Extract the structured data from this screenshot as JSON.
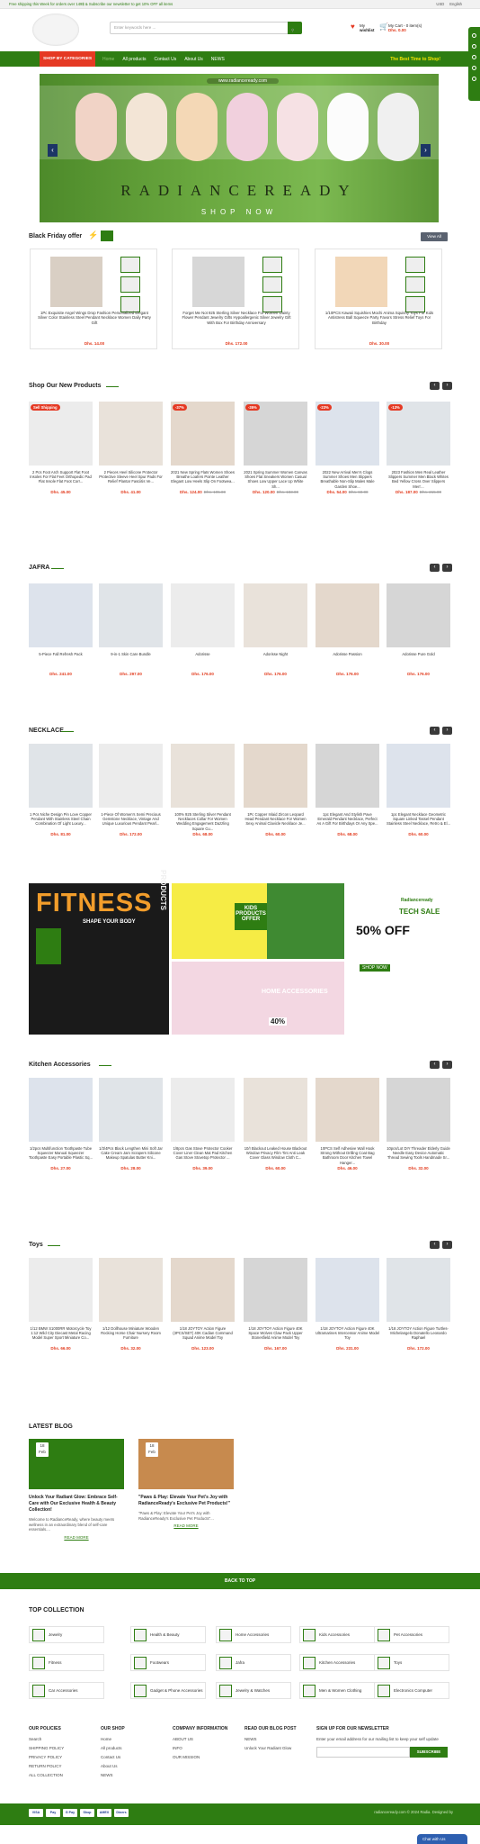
{
  "topbar": {
    "promo": "Free shipping this Week for orders over 149$ & Subscribe our newsletter to get 10% OFF all items",
    "currency": "USD",
    "language": "English"
  },
  "header": {
    "search_placeholder": "Enter keywords here ...",
    "wishlist_line1": "My",
    "wishlist_line2": "wishlist",
    "cart_line1": "My Cart - 0 item(s)",
    "cart_price": "Dhs. 0.00"
  },
  "nav": {
    "categories": "SHOP BY CATEGORIES",
    "links": [
      "Home",
      "All products",
      "Contact Us",
      "About Us",
      "NEWS"
    ],
    "best_time": "The Best Time to Shop!"
  },
  "hero": {
    "url": "www.radianceready.com",
    "brand": "RADIANCEREADY",
    "cta": "SHOP NOW"
  },
  "black_friday": {
    "title": "Black Friday offer",
    "view_all": "View All",
    "cards": [
      {
        "name": "1Pc Exquisite Angel Wings Drop Fashion Personalized Elegant Silver Color Stainless Steel Pendant Necklace Women Daily Party Gift",
        "price": "Dhs. 14.00"
      },
      {
        "name": "Forget Me Not 925 Sterling Silver Necklace For Women Dainty Flower Pendant Jewelry Gifts Hypoallergenic Silver Jewelry Gift With Box For Birthday Anniversary",
        "price": "Dhs. 172.00"
      },
      {
        "name": "1/10PCS Kawaii Squishies Mochi Anima Squishy Toys For Kids Antistress Ball Squeeze Party Favors Stress Relief Toys For Birthday",
        "price": "Dhs. 30.00"
      }
    ]
  },
  "new_products": {
    "title": "Shop Our New Products",
    "items": [
      {
        "badge": "Sell Shipping",
        "name": "2 Pcs Foot Arch Support Flat Foot Insoles For Flat Feet Orthopedic Pad Flat Insole Flat Foot Corr...",
        "price": "Dhs. 45.00",
        "old": ""
      },
      {
        "badge": "",
        "name": "2 Pieces Heel Silicone Protector Protective Sleeve Heel Spur Pads For Relief Plantar Fasciitis Ve...",
        "price": "Dhs. 41.00",
        "old": ""
      },
      {
        "badge": "-37%",
        "name": "2021 New Spring Flats Women Shoes Breathe Loafers Pointe Leather Elegant Low Heels Slip On Footwea...",
        "price": "Dhs. 124.00",
        "old": "Dhs. 195.00"
      },
      {
        "badge": "-35%",
        "name": "2021 Spring Summer Women Canvas Shoes Flat Sneakers Women Casual Shoes Low Upper Lace Up White Sh...",
        "price": "Dhs. 120.00",
        "old": "Dhs. 183.00"
      },
      {
        "badge": "-23%",
        "name": "2022 New Arrival Men's Clogs Summer Shoes Men Slippers Breathable Non-Slip Males Male Garden Shoe...",
        "price": "Dhs. 54.00",
        "old": "Dhs. 69.00"
      },
      {
        "badge": "-13%",
        "name": "2023 Fashion Men Real Leather Slippers Summer Men Black Whites Bed Yellow Cross Over Slippers Men'...",
        "price": "Dhs. 187.00",
        "old": "Dhs. 215.00"
      }
    ]
  },
  "jafra": {
    "title": "JAFRA",
    "items": [
      {
        "name": "5-Piece Fall Refresh Pack",
        "price": "Dhs. 241.00"
      },
      {
        "name": "9-in-1 Skin Care Bundle",
        "price": "Dhs. 297.00"
      },
      {
        "name": "Adorisse",
        "price": "Dhs. 176.00"
      },
      {
        "name": "Adorisse Night",
        "price": "Dhs. 176.00"
      },
      {
        "name": "Adorisse Passion",
        "price": "Dhs. 176.00"
      },
      {
        "name": "Adorisse Pure Gold",
        "price": "Dhs. 176.00"
      }
    ]
  },
  "necklace": {
    "title": "NECKLACE",
    "items": [
      {
        "name": "1 Pcs Niche Design Pin Love Copper Pendant With Stainless Steel Chain Combination Of Light Luxury...",
        "price": "Dhs. 81.00"
      },
      {
        "name": "1-Piece Of Women's Semi Precious Gemstone Necklace, Vintage And Unique Luxurious Pendant Pearl...",
        "price": "Dhs. 172.00"
      },
      {
        "name": "100% 925 Sterling Silver Pendant Necklaces Collar For Women Wedding Engagement Dazzling Square Cu...",
        "price": "Dhs. 68.00"
      },
      {
        "name": "1Pc Copper Inlaid Zircon Leopard Head Pendant Necklace For Women Sexy Animal Clavicle Necklace Je...",
        "price": "Dhs. 60.00"
      },
      {
        "name": "1pc Elegant And Stylish Pave Emerald Pendant Necklace, Perfect As A Gift For Birthdays Or Any Spe...",
        "price": "Dhs. 68.00"
      },
      {
        "name": "1pc Elegant Necklace Geometric Square Linked Tassel Pendant Stainless Steel Necklace, Retro & El...",
        "price": "Dhs. 60.00"
      }
    ]
  },
  "banners": {
    "fitness_title": "FITNESS",
    "fitness_word": "PRODUCTS",
    "fitness_sub": "SHAPE YOUR BODY",
    "kids_text": "KIDS PRODUCTS OFFER",
    "home_title": "HOME ACCESSORIES",
    "home_discount": "40%",
    "tech_brand": "Radianceready",
    "tech_title": "TECH SALE",
    "tech_discount": "50% OFF",
    "tech_cta": "SHOP NOW"
  },
  "kitchen": {
    "title": "Kitchen Accessories",
    "items": [
      {
        "name": "1/2pcs Multifunction Toothpaste Tube Squeezer Manual Squeezer Toothpaste Easy Portable Plastic Sq...",
        "price": "Dhs. 27.00"
      },
      {
        "name": "1/3/4Pcs Black Lengthen Mini Soft Jar Cake Cream Jam Scrapers Silicone Makeup Spatulas Butter Kni...",
        "price": "Dhs. 28.00"
      },
      {
        "name": "1/8pcs Gas Stove Protector Cooker Cover Liner Clean Mat Pad Kitchen Gas Stove Stovetop Protector ...",
        "price": "Dhs. 39.00"
      },
      {
        "name": "10/I Blackout Leaked House Blackout Window Privacy Film Tint Anti Leak Cover Glass Window Cloth C...",
        "price": "Dhs. 60.00"
      },
      {
        "name": "10PCS Self Adhesive Wall Hook Strong Without Drilling Coat Bag Bathroom Door Kitchen Towel Hanger...",
        "price": "Dhs. 46.00"
      },
      {
        "name": "10pcs/Lot DIY Threader Elderly Guide Needle Easy Device Automatic Thread Sewing Tools Handmade Sr...",
        "price": "Dhs. 32.00"
      }
    ]
  },
  "toys": {
    "title": "Toys",
    "items": [
      {
        "name": "1/12 BMW S1000RR Motorcycle Toy 1:12 Wild City Diecast Metal Racing Model Super Sport Miniature Co...",
        "price": "Dhs. 66.00"
      },
      {
        "name": "1/12 Dollhouse Miniature Wooden Rocking Horse Chair Nursery Room Furniture",
        "price": "Dhs. 32.00"
      },
      {
        "name": "1/18 JOYTOY Action Figure (3PCS/SET) 40K Cadian Command Squad Anime Model Toy",
        "price": "Dhs. 123.00"
      },
      {
        "name": "1/18 JOYTOY Action Figure 40K Space Wolves Claw Pack Upper Stonesfield Anime Model Toy",
        "price": "Dhs. 167.00"
      },
      {
        "name": "1/18 JOYTOY Action Figure 40K Ultramarines Intercessor Anime Model Toy",
        "price": "Dhs. 231.00"
      },
      {
        "name": "1/18 JOYTOY Action Figure Turtles-Michelangelo Donatello Leonardo Raphael",
        "price": "Dhs. 172.00"
      }
    ]
  },
  "blog": {
    "title": "LATEST BLOG",
    "posts": [
      {
        "day": "18",
        "month": "Feb",
        "title": "Unlock Your Radiant Glow: Embrace Self-Care with Our Exclusive Health & Beauty Collection!",
        "excerpt": "Welcome to RadianceReady, where beauty meets wellness in an extraordinary blend of self-care essentials....",
        "more": "READ MORE"
      },
      {
        "day": "18",
        "month": "Feb",
        "title": "\"Paws & Play: Elevate Your Pet's Joy with RadianceReady's Exclusive Pet Products!\"",
        "excerpt": "\"Paws & Play: Elevate Your Pet's Joy with RadianceReady's Exclusive Pet Products\"...",
        "more": "READ MORE"
      }
    ]
  },
  "backtop": "BACK TO TOP",
  "top_collection": {
    "title": "TOP COLLECTION",
    "items": [
      "Jewelry",
      "Health & Beauty",
      "Home Accessories",
      "Kids Accessories",
      "Pet Accessories",
      "Fitness",
      "Footwears",
      "Jafra",
      "Kitchen Accessories",
      "Toys",
      "Car Accessories",
      "Gadget & Phone Accessories",
      "Jewelry & Watches",
      "Men & Women Clothing",
      "Electronics Computer"
    ]
  },
  "footer": {
    "cols": [
      {
        "title": "OUR POLICIES",
        "items": [
          "Search",
          "SHIPPING POLICY",
          "PRIVACY POLICY",
          "RETURN POLICY",
          "ALL COLLECTION"
        ]
      },
      {
        "title": "OUR SHOP",
        "items": [
          "Home",
          "All products",
          "Contact Us",
          "About Us",
          "NEWS"
        ]
      },
      {
        "title": "COMPANY INFORMATION",
        "items": [
          "ABOUT US",
          "INFO",
          "OUR MISSION"
        ]
      },
      {
        "title": "READ OUR BLOG POST",
        "items": [
          "NEWS",
          "Unlock Your Radiant Glow"
        ]
      }
    ],
    "newsletter_title": "SIGN UP FOR OUR NEWSLETTER",
    "newsletter_text": "Enter your email address for our mailing list to keep your self update",
    "subscribe": "SUBSCRIBE",
    "payments": [
      "VISA",
      "Pay",
      "G Pay",
      "Shop",
      "AMEX",
      "Diners"
    ],
    "copyright": "radianceready.com © 2024 Radia. Designed by",
    "chat": "Chat with Us"
  },
  "colors": {
    "brand": "#2e7d12",
    "sale": "#e53923",
    "price": "#e23a1c"
  }
}
